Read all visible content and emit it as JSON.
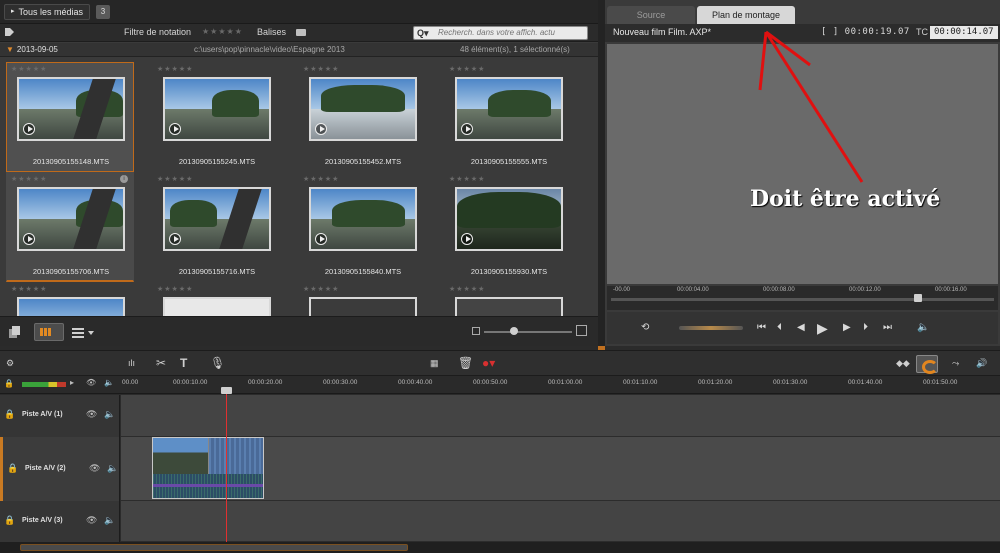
{
  "library": {
    "media_button": "Tous les médias",
    "media_count": "3",
    "filter_label": "Filtre de notation",
    "filter_stars": "★★★★★",
    "tags_label": "Balises",
    "search_placeholder": "Recherch. dans votre affich. actu",
    "folder_name": "2013-09-05",
    "folder_path": "c:\\users\\pop\\pinnacle\\video\\Espagne 2013",
    "folder_count": "48 élément(s), 1 sélectionné(s)",
    "items": [
      {
        "name": "20130905155148.MTS",
        "stars": "★★★★★"
      },
      {
        "name": "20130905155245.MTS",
        "stars": "★★★★★"
      },
      {
        "name": "20130905155452.MTS",
        "stars": "★★★★★"
      },
      {
        "name": "20130905155555.MTS",
        "stars": "★★★★★"
      },
      {
        "name": "20130905155706.MTS",
        "stars": "★★★★★"
      },
      {
        "name": "20130905155716.MTS",
        "stars": "★★★★★"
      },
      {
        "name": "20130905155840.MTS",
        "stars": "★★★★★"
      },
      {
        "name": "20130905155930.MTS",
        "stars": "★★★★★"
      },
      {
        "name": "",
        "stars": "★★★★★"
      },
      {
        "name": "",
        "stars": "★★★★★"
      },
      {
        "name": "",
        "stars": "★★★★★"
      },
      {
        "name": "",
        "stars": "★★★★★"
      }
    ]
  },
  "player": {
    "tab_source": "Source",
    "tab_montage": "Plan de montage",
    "film_name": "Nouveau film Film. AXP*",
    "timecode_position": "[ ]  00:00:19.07",
    "tc_label": "TC",
    "timecode_total": "00:00:14.07",
    "scrub_ticks": [
      "-00.00",
      "00:00:04.00",
      "00:00:08.00",
      "00:00:12.00",
      "00:00:16.00"
    ]
  },
  "timeline": {
    "ruler_ticks": [
      "00.00",
      "00:00:10.00",
      "00:00:20.00",
      "00:00:30.00",
      "00:00:40.00",
      "00:00:50.00",
      "00:01:00.00",
      "00:01:10.00",
      "00:01:20.00",
      "00:01:30.00",
      "00:01:40.00",
      "00:01:50.00"
    ],
    "tracks": [
      {
        "name": "Piste A/V (1)"
      },
      {
        "name": "Piste A/V (2)"
      },
      {
        "name": "Piste A/V (3)"
      }
    ]
  },
  "annotation": {
    "text": "Doit être activé",
    "color": "#e01010"
  },
  "colors": {
    "accent": "#e2861f",
    "playhead": "#e03030"
  }
}
